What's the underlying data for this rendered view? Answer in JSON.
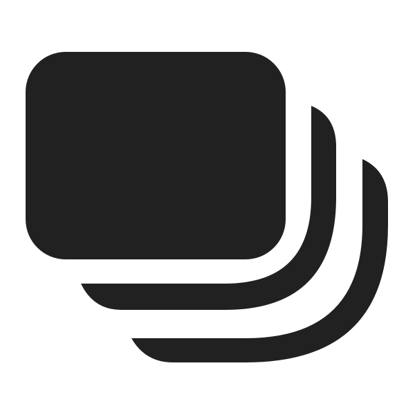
{
  "icon": {
    "name": "stacked-cards-icon",
    "color": "#212121",
    "background": "#ffffff"
  }
}
